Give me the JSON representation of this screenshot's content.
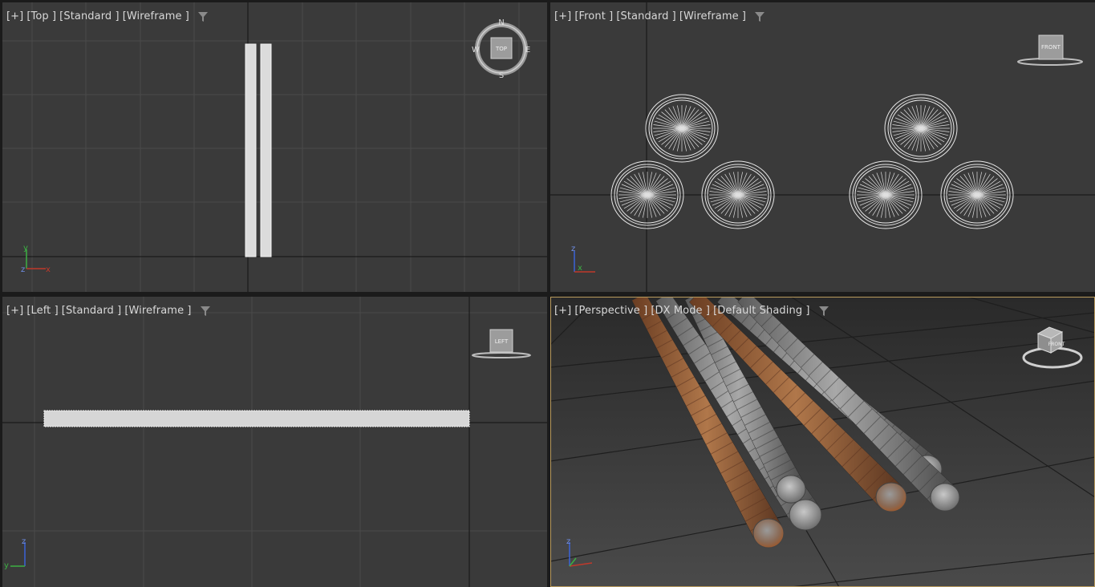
{
  "viewports": {
    "top": {
      "menu": "[+]",
      "view": "[Top ]",
      "mode": "[Standard ]",
      "shading": "[Wireframe ]"
    },
    "front": {
      "menu": "[+]",
      "view": "[Front ]",
      "mode": "[Standard ]",
      "shading": "[Wireframe ]"
    },
    "left": {
      "menu": "[+]",
      "view": "[Left ]",
      "mode": "[Standard ]",
      "shading": "[Wireframe ]"
    },
    "perspective": {
      "menu": "[+]",
      "view": "[Perspective ]",
      "mode": "[DX Mode ]",
      "shading": "[Default Shading ]"
    }
  },
  "viewcube": {
    "top_face": "TOP",
    "front_face": "FRONT",
    "left_face": "LEFT",
    "compass": {
      "n": "N",
      "s": "S",
      "e": "E",
      "w": "W"
    }
  },
  "axes": {
    "x": "x",
    "y": "y",
    "z": "z"
  },
  "colors": {
    "viewport_bg": "#3a3a3a",
    "grid": "#4a4a4a",
    "active_border": "#b99a5d",
    "axis_x": "#c0392b",
    "axis_y": "#3cb043",
    "axis_z": "#3a63d8",
    "rust": "#a86a3f",
    "steel": "#8a8a8a"
  }
}
